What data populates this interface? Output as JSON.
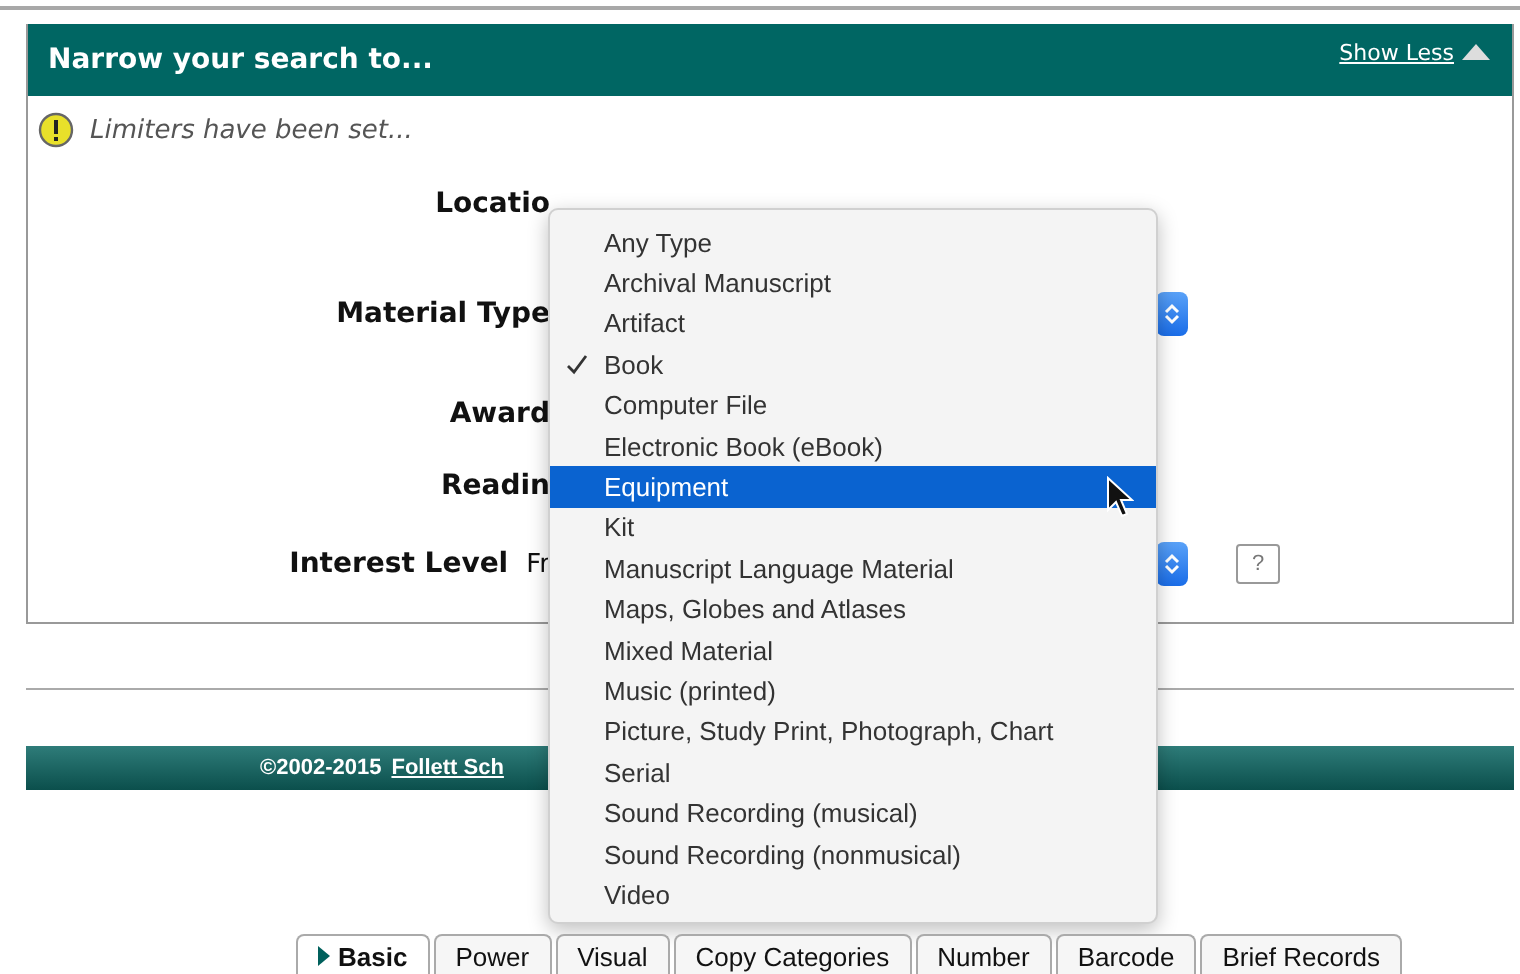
{
  "panel": {
    "title": "Narrow your search to...",
    "toggle_link": "Show Less",
    "notice": "Limiters have been set..."
  },
  "fields": [
    {
      "label": "Locatio",
      "select": false,
      "help": false
    },
    {
      "label": "Material Type",
      "select": true,
      "help": false
    },
    {
      "label": "Award",
      "select": false,
      "help": false
    },
    {
      "label": "Readin",
      "select": false,
      "help": false
    },
    {
      "label": "Interest Level",
      "value": "Fr",
      "select": true,
      "help": "?"
    }
  ],
  "footer": {
    "copyright": "©2002-2015",
    "link": "Follett Sch"
  },
  "menu": [
    {
      "label": "Any Type",
      "checked": false,
      "selected": false
    },
    {
      "label": "Archival Manuscript",
      "checked": false,
      "selected": false
    },
    {
      "label": "Artifact",
      "checked": false,
      "selected": false
    },
    {
      "label": "Book",
      "checked": true,
      "selected": false
    },
    {
      "label": "Computer File",
      "checked": false,
      "selected": false
    },
    {
      "label": "Electronic Book (eBook)",
      "checked": false,
      "selected": false
    },
    {
      "label": "Equipment",
      "checked": false,
      "selected": true
    },
    {
      "label": "Kit",
      "checked": false,
      "selected": false
    },
    {
      "label": "Manuscript Language Material",
      "checked": false,
      "selected": false
    },
    {
      "label": "Maps, Globes and Atlases",
      "checked": false,
      "selected": false
    },
    {
      "label": "Mixed Material",
      "checked": false,
      "selected": false
    },
    {
      "label": "Music (printed)",
      "checked": false,
      "selected": false
    },
    {
      "label": "Picture, Study Print, Photograph, Chart",
      "checked": false,
      "selected": false
    },
    {
      "label": "Serial",
      "checked": false,
      "selected": false
    },
    {
      "label": "Sound Recording (musical)",
      "checked": false,
      "selected": false
    },
    {
      "label": "Sound Recording (nonmusical)",
      "checked": false,
      "selected": false
    },
    {
      "label": "Video",
      "checked": false,
      "selected": false
    }
  ],
  "tabs": [
    {
      "label": "Basic",
      "selected": true
    },
    {
      "label": "Power",
      "selected": false
    },
    {
      "label": "Visual",
      "selected": false
    },
    {
      "label": "Copy Categories",
      "selected": false
    },
    {
      "label": "Number",
      "selected": false
    },
    {
      "label": "Barcode",
      "selected": false
    },
    {
      "label": "Brief Records",
      "selected": false
    }
  ]
}
